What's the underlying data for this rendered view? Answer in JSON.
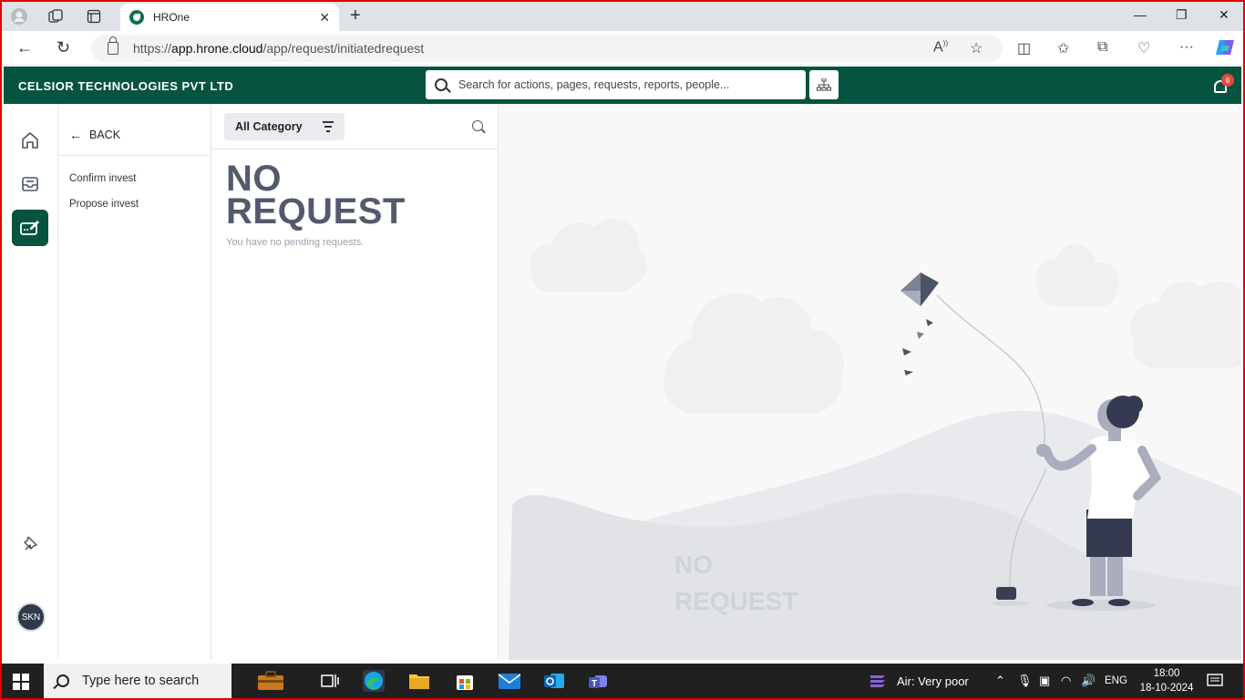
{
  "browser": {
    "tab_title": "HROne",
    "url_prefix": "https://",
    "url_host": "app.hrone.cloud",
    "url_path": "/app/request/initiatedrequest"
  },
  "header": {
    "company_name": "CELSIOR TECHNOLOGIES PVT LTD",
    "search_placeholder": "Search for actions, pages, requests, reports, people...",
    "notification_count": "8"
  },
  "sidebar": {
    "avatar_initials": "SKN"
  },
  "submenu": {
    "back_label": "BACK",
    "items": [
      {
        "label": "Confirm invest"
      },
      {
        "label": "Propose invest"
      }
    ]
  },
  "list": {
    "category_label": "All Category",
    "empty_title_line1": "NO",
    "empty_title_line2": "REQUEST",
    "empty_subtitle": "You have no pending requests."
  },
  "illustration": {
    "line1": "NO",
    "line2": "REQUEST"
  },
  "taskbar": {
    "search_placeholder": "Type here to search",
    "weather": "Air: Very poor",
    "language": "ENG",
    "time": "18:00",
    "date": "18-10-2024"
  },
  "colors": {
    "brand_green": "#06543f",
    "badge_red": "#e8483c"
  }
}
